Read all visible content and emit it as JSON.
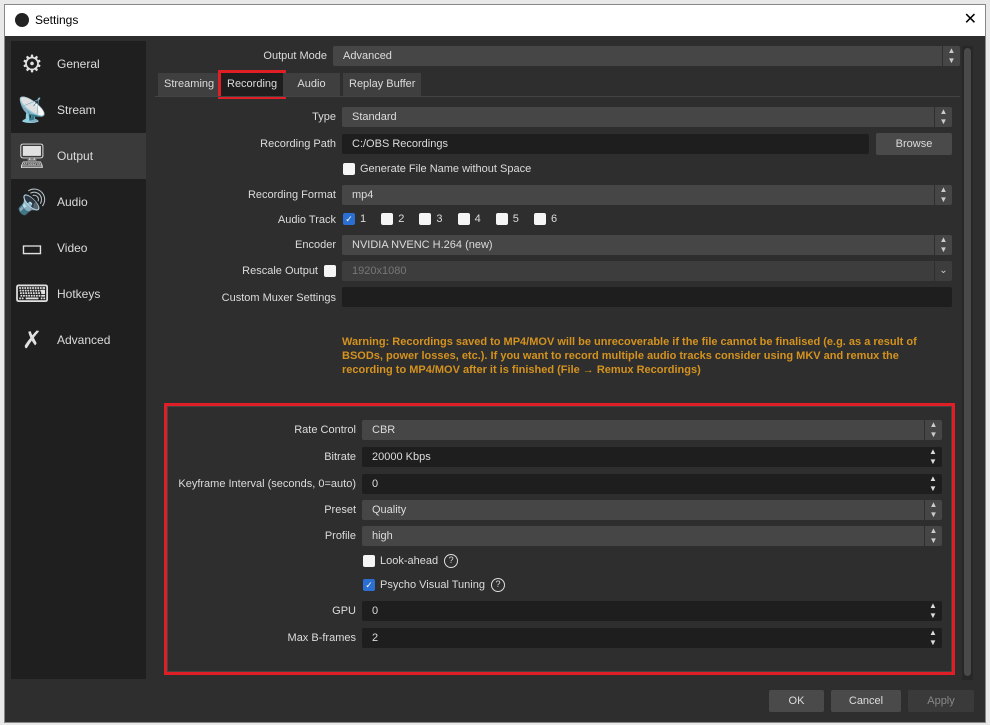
{
  "window": {
    "title": "Settings",
    "close": "✕"
  },
  "sidebar": {
    "items": [
      {
        "label": "General",
        "icon": "⚙"
      },
      {
        "label": "Stream",
        "icon": "📡"
      },
      {
        "label": "Output",
        "icon": "🖥"
      },
      {
        "label": "Audio",
        "icon": "🔊"
      },
      {
        "label": "Video",
        "icon": "▭"
      },
      {
        "label": "Hotkeys",
        "icon": "⌨"
      },
      {
        "label": "Advanced",
        "icon": "✗"
      }
    ]
  },
  "output_mode": {
    "label": "Output Mode",
    "value": "Advanced"
  },
  "tabs": [
    "Streaming",
    "Recording",
    "Audio",
    "Replay Buffer"
  ],
  "recording": {
    "type_label": "Type",
    "type": "Standard",
    "path_label": "Recording Path",
    "path": "C:/OBS Recordings",
    "browse": "Browse",
    "gen_name": "Generate File Name without Space",
    "format_label": "Recording Format",
    "format": "mp4",
    "track_label": "Audio Track",
    "tracks": [
      "1",
      "2",
      "3",
      "4",
      "5",
      "6"
    ],
    "encoder_label": "Encoder",
    "encoder": "NVIDIA NVENC H.264 (new)",
    "rescale_label": "Rescale Output",
    "rescale": "1920x1080",
    "muxer_label": "Custom Muxer Settings",
    "muxer": "",
    "warning": "Warning: Recordings saved to MP4/MOV will be unrecoverable if the file cannot be finalised (e.g. as a result of BSODs, power losses, etc.). If you want to record multiple audio tracks consider using MKV and remux the recording to MP4/MOV after it is finished (File → Remux Recordings)"
  },
  "encoder_settings": {
    "rate_label": "Rate Control",
    "rate": "CBR",
    "bitrate_label": "Bitrate",
    "bitrate": "20000 Kbps",
    "keyframe_label": "Keyframe Interval (seconds, 0=auto)",
    "keyframe": "0",
    "preset_label": "Preset",
    "preset": "Quality",
    "profile_label": "Profile",
    "profile": "high",
    "lookahead": "Look-ahead",
    "psycho": "Psycho Visual Tuning",
    "gpu_label": "GPU",
    "gpu": "0",
    "bframes_label": "Max B-frames",
    "bframes": "2"
  },
  "buttons": {
    "ok": "OK",
    "cancel": "Cancel",
    "apply": "Apply"
  }
}
